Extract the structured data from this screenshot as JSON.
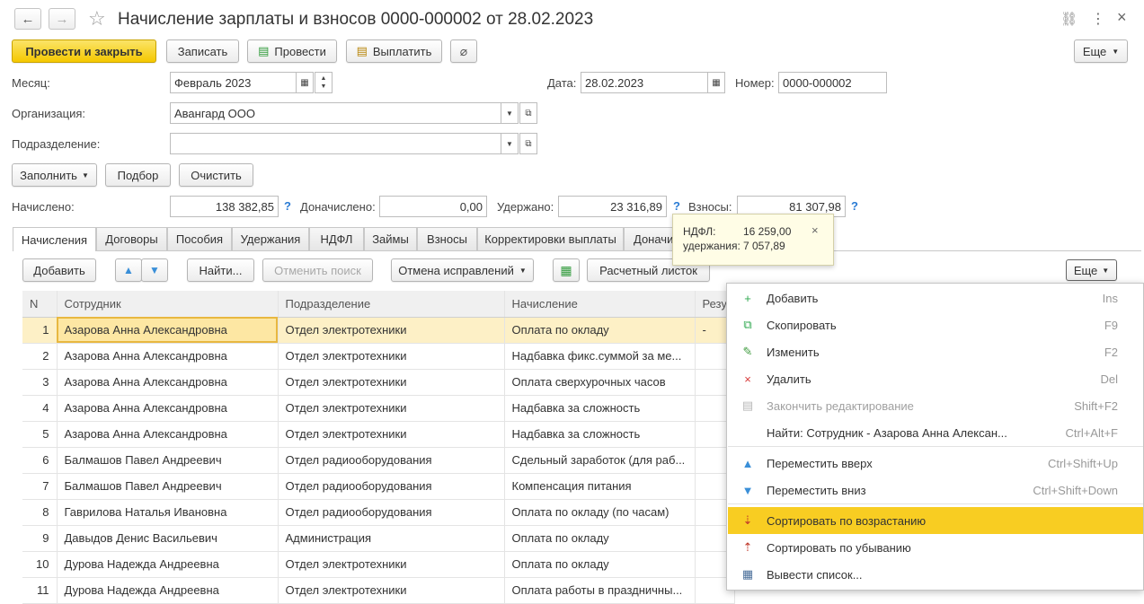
{
  "window": {
    "title": "Начисление зарплаты и взносов 0000-000002 от 28.02.2023",
    "more_icon": "⋮",
    "close_icon": "×",
    "link_icon": "🔗"
  },
  "toolbar": {
    "post_close": "Провести и закрыть",
    "save": "Записать",
    "post": "Провести",
    "pay": "Выплатить",
    "more": "Еще"
  },
  "form": {
    "month_label": "Месяц:",
    "month_value": "Февраль 2023",
    "date_label": "Дата:",
    "date_value": "28.02.2023",
    "number_label": "Номер:",
    "number_value": "0000-000002",
    "org_label": "Организация:",
    "org_value": "Авангард ООО",
    "dept_label": "Подразделение:",
    "dept_value": ""
  },
  "actions": {
    "fill": "Заполнить",
    "pick": "Подбор",
    "clear": "Очистить"
  },
  "totals": {
    "accrued_label": "Начислено:",
    "accrued_value": "138 382,85",
    "extra_label": "Доначислено:",
    "extra_value": "0,00",
    "withheld_label": "Удержано:",
    "withheld_value": "23 316,89",
    "contrib_label": "Взносы:",
    "contrib_value": "81 307,98",
    "help": "?"
  },
  "tooltip": {
    "ndfl_label": "НДФЛ:",
    "ndfl_value": "16 259,00",
    "hold_label": "удержания:",
    "hold_value": "7 057,89",
    "close": "×"
  },
  "tabs": [
    "Начисления",
    "Договоры",
    "Пособия",
    "Удержания",
    "НДФЛ",
    "Займы",
    "Взносы",
    "Корректировки выплаты",
    "Доначи"
  ],
  "grid_toolbar": {
    "add": "Добавить",
    "find": "Найти...",
    "cancel_search": "Отменить поиск",
    "undo_fix": "Отмена исправлений",
    "payslip": "Расчетный листок",
    "more": "Еще"
  },
  "table": {
    "columns": [
      "N",
      "Сотрудник",
      "Подразделение",
      "Начисление",
      "Резу"
    ],
    "rows": [
      {
        "n": "1",
        "emp": "Азарова Анна Александровна",
        "dept": "Отдел электротехники",
        "acc": "Оплата по окладу",
        "res": "-"
      },
      {
        "n": "2",
        "emp": "Азарова Анна Александровна",
        "dept": "Отдел электротехники",
        "acc": "Надбавка фикс.суммой за ме...",
        "res": ""
      },
      {
        "n": "3",
        "emp": "Азарова Анна Александровна",
        "dept": "Отдел электротехники",
        "acc": "Оплата сверхурочных часов",
        "res": ""
      },
      {
        "n": "4",
        "emp": "Азарова Анна Александровна",
        "dept": "Отдел электротехники",
        "acc": "Надбавка за сложность",
        "res": ""
      },
      {
        "n": "5",
        "emp": "Азарова Анна Александровна",
        "dept": "Отдел электротехники",
        "acc": "Надбавка за сложность",
        "res": ""
      },
      {
        "n": "6",
        "emp": "Балмашов Павел Андреевич",
        "dept": "Отдел радиооборудования",
        "acc": "Сдельный заработок (для раб...",
        "res": ""
      },
      {
        "n": "7",
        "emp": "Балмашов Павел Андреевич",
        "dept": "Отдел радиооборудования",
        "acc": "Компенсация питания",
        "res": ""
      },
      {
        "n": "8",
        "emp": "Гаврилова Наталья Ивановна",
        "dept": "Отдел радиооборудования",
        "acc": "Оплата по окладу (по часам)",
        "res": ""
      },
      {
        "n": "9",
        "emp": "Давыдов Денис Васильевич",
        "dept": "Администрация",
        "acc": "Оплата по окладу",
        "res": ""
      },
      {
        "n": "10",
        "emp": "Дурова Надежда Андреевна",
        "dept": "Отдел электротехники",
        "acc": "Оплата по окладу",
        "res": ""
      },
      {
        "n": "11",
        "emp": "Дурова Надежда Андреевна",
        "dept": "Отдел электротехники",
        "acc": "Оплата работы в праздничны...",
        "res": ""
      }
    ]
  },
  "menu": [
    {
      "label": "Добавить",
      "key": "Ins",
      "icon": "add-icon",
      "color": "#2fa84f",
      "glyph": "+",
      "disabled": false,
      "highlight": false
    },
    {
      "label": "Скопировать",
      "key": "F9",
      "icon": "copy-icon",
      "color": "#2fa84f",
      "glyph": "⧉",
      "disabled": false,
      "highlight": false
    },
    {
      "label": "Изменить",
      "key": "F2",
      "icon": "pencil-icon",
      "color": "#3c9a3c",
      "glyph": "✎",
      "disabled": false,
      "highlight": false
    },
    {
      "label": "Удалить",
      "key": "Del",
      "icon": "delete-icon",
      "color": "#d83a3a",
      "glyph": "×",
      "disabled": false,
      "highlight": false
    },
    {
      "label": "Закончить редактирование",
      "key": "Shift+F2",
      "icon": "end-edit-icon",
      "color": "#b8b8b8",
      "glyph": "▤",
      "disabled": true,
      "highlight": false
    },
    {
      "label": "Найти: Сотрудник - Азарова Анна Алексан...",
      "key": "Ctrl+Alt+F",
      "icon": "",
      "color": "",
      "glyph": "",
      "disabled": false,
      "highlight": false
    },
    {
      "label": "Переместить вверх",
      "key": "Ctrl+Shift+Up",
      "icon": "arrow-up-icon",
      "color": "#3a8fd8",
      "glyph": "▲",
      "disabled": false,
      "highlight": false
    },
    {
      "label": "Переместить вниз",
      "key": "Ctrl+Shift+Down",
      "icon": "arrow-down-icon",
      "color": "#3a8fd8",
      "glyph": "▼",
      "disabled": false,
      "highlight": false
    },
    {
      "label": "Сортировать по возрастанию",
      "key": "",
      "icon": "sort-asc-icon",
      "color": "#c0392b",
      "glyph": "⇣",
      "disabled": false,
      "highlight": true
    },
    {
      "label": "Сортировать по убыванию",
      "key": "",
      "icon": "sort-desc-icon",
      "color": "#c0392b",
      "glyph": "⇡",
      "disabled": false,
      "highlight": false
    },
    {
      "label": "Вывести список...",
      "key": "",
      "icon": "print-list-icon",
      "color": "#4a6f9a",
      "glyph": "▦",
      "disabled": false,
      "highlight": false
    }
  ]
}
